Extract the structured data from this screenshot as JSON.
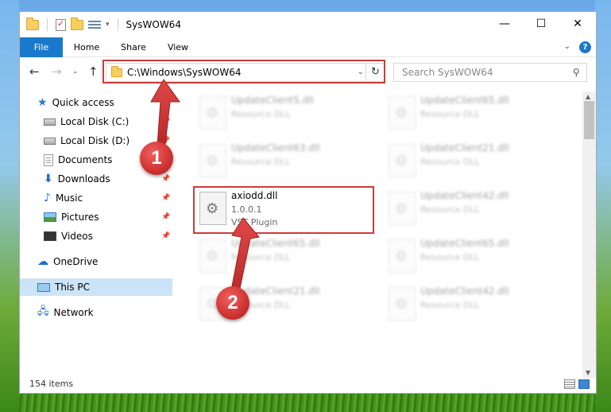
{
  "window": {
    "title": "SysWOW64",
    "controls": {
      "minimize": "—",
      "maximize": "☐",
      "close": "✕"
    }
  },
  "ribbon": {
    "tabs": [
      "File",
      "Home",
      "Share",
      "View"
    ],
    "help": "?"
  },
  "nav": {
    "address": "C:\\Windows\\SysWOW64",
    "search_placeholder": "Search SysWOW64",
    "back": "←",
    "forward": "→",
    "up": "↑",
    "recent": "⌄",
    "refresh": "↻"
  },
  "sidebar": {
    "items": [
      {
        "label": "Quick access",
        "icon": "quick-access-star-icon"
      },
      {
        "label": "Local Disk (C:)",
        "icon": "drive-icon",
        "pinned": true
      },
      {
        "label": "Local Disk (D:)",
        "icon": "drive-icon",
        "pinned": true
      },
      {
        "label": "Documents",
        "icon": "documents-icon",
        "pinned": true
      },
      {
        "label": "Downloads",
        "icon": "download-arrow-icon",
        "pinned": true
      },
      {
        "label": "Music",
        "icon": "music-note-icon",
        "pinned": true
      },
      {
        "label": "Pictures",
        "icon": "pictures-icon",
        "pinned": true
      },
      {
        "label": "Videos",
        "icon": "videos-icon",
        "pinned": true
      },
      {
        "label": "OneDrive",
        "icon": "cloud-icon"
      },
      {
        "label": "This PC",
        "icon": "computer-icon",
        "selected": true
      },
      {
        "label": "Network",
        "icon": "network-icon"
      }
    ]
  },
  "files": [
    {
      "name": "UpdateClient5.dll",
      "type": "Resource DLL"
    },
    {
      "name": "UpdateClient65.dll",
      "type": "Resource DLL"
    },
    {
      "name": "UpdateClient63.dll",
      "type": "Resource DLL"
    },
    {
      "name": "UpdateClient21.dll",
      "type": "Resource DLL"
    },
    {
      "name": "axiodd.dll",
      "version": "1.0.0.1",
      "type": "VST Plugin"
    },
    {
      "name": "UpdateClient42.dll",
      "type": "Resource DLL"
    },
    {
      "name": "UpdateClient65.dll",
      "type": "Resource DLL"
    },
    {
      "name": "UpdateClient65.dll",
      "type": "Resource DLL"
    },
    {
      "name": "UpdateClient21.dll",
      "type": "Resource DLL"
    },
    {
      "name": "UpdateClient42.dll",
      "type": "Resource DLL"
    }
  ],
  "status": {
    "count": "154 items"
  },
  "callouts": [
    "1",
    "2"
  ],
  "colors": {
    "accent": "#1979ca",
    "highlight": "#cc3c3c",
    "selection": "#cce4f7"
  }
}
